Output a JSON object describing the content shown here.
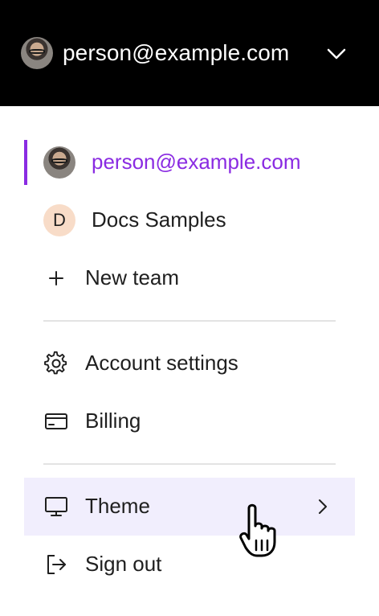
{
  "header": {
    "account_email": "person@example.com",
    "avatar": "user-photo",
    "dropdown_icon": "chevron-down-icon"
  },
  "menu": {
    "teams": [
      {
        "label": "person@example.com",
        "avatar": "user-photo",
        "active": true
      },
      {
        "label": "Docs Samples",
        "avatar_letter": "D",
        "active": false
      }
    ],
    "new_team": {
      "label": "New team",
      "icon": "plus-icon"
    },
    "account_settings": {
      "label": "Account settings",
      "icon": "gear-icon"
    },
    "billing": {
      "label": "Billing",
      "icon": "credit-card-icon"
    },
    "theme": {
      "label": "Theme",
      "icon": "monitor-icon",
      "submenu_icon": "chevron-right-icon"
    },
    "sign_out": {
      "label": "Sign out",
      "icon": "sign-out-icon"
    }
  },
  "colors": {
    "header_bg": "#000000",
    "accent": "#8a2be2",
    "hover_bg": "#f1eefd",
    "team_avatar_bg": "#f8dcc8"
  }
}
